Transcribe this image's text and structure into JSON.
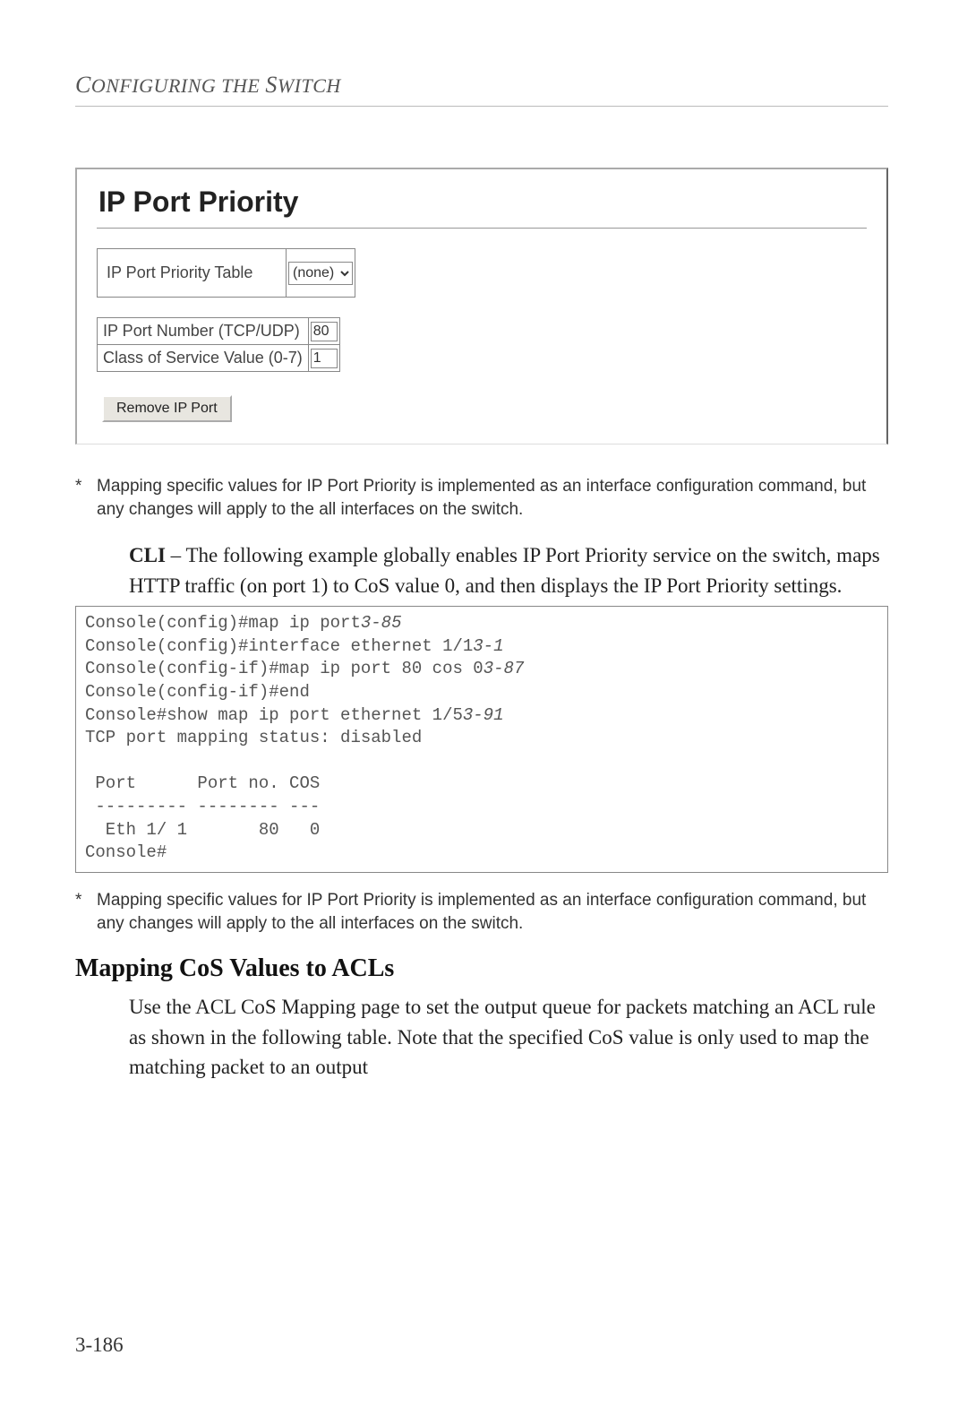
{
  "running_head": "Configuring the Switch",
  "ui": {
    "title": "IP Port Priority",
    "table_label": "IP Port Priority Table",
    "table_select_value": "(none)",
    "port_number_label": "IP Port Number (TCP/UDP)",
    "port_number_value": "80",
    "cos_label": "Class of Service Value (0-7)",
    "cos_value": "1",
    "remove_button": "Remove IP Port"
  },
  "footnote1": "Mapping specific values for IP Port Priority is implemented as an interface configuration command, but any changes will apply to the all interfaces on the switch.",
  "cli": {
    "lead": "CLI",
    "para": "– The following example globally enables IP Port Priority service on the switch, maps HTTP traffic (on port 1) to CoS value 0, and then displays the IP Port Priority settings.",
    "l1a": "Console(config)#map ip port",
    "l1b": "3-85",
    "l2a": "Console(config)#interface ethernet 1/1",
    "l2b": "3-1",
    "l3a": "Console(config-if)#map ip port 80 cos 0",
    "l3b": "3-87",
    "l4": "Console(config-if)#end",
    "l5a": "Console#show map ip port ethernet 1/5",
    "l5b": "3-91",
    "l6": "TCP port mapping status: disabled",
    "l7": "",
    "l8": " Port      Port no. COS",
    "l9": " --------- -------- ---",
    "l10": "  Eth 1/ 1       80   0",
    "l11": "Console#"
  },
  "footnote2": "Mapping specific values for IP Port Priority is implemented as an interface configuration command, but any changes will apply to the all interfaces on the switch.",
  "section2": {
    "heading": "Mapping CoS Values to ACLs",
    "para": "Use the ACL CoS Mapping page to set the output queue for packets matching an ACL rule as shown in the following table. Note that the specified CoS value is only used to map the matching packet to an output"
  },
  "page_number": "3-186"
}
